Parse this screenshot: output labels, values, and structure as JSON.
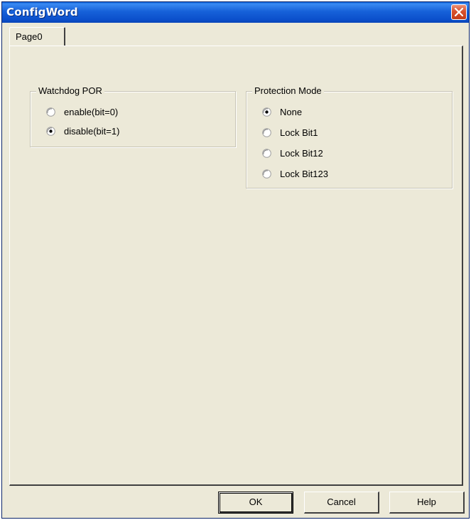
{
  "window": {
    "title": "ConfigWord"
  },
  "tabs": [
    {
      "label": "Page0",
      "selected": true
    }
  ],
  "watchdog": {
    "title": "Watchdog POR",
    "options": [
      {
        "label": "enable(bit=0)",
        "checked": false
      },
      {
        "label": "disable(bit=1)",
        "checked": true
      }
    ]
  },
  "protection": {
    "title": "Protection Mode",
    "options": [
      {
        "label": "None",
        "checked": true
      },
      {
        "label": "Lock Bit1",
        "checked": false
      },
      {
        "label": "Lock Bit12",
        "checked": false
      },
      {
        "label": "Lock Bit123",
        "checked": false
      }
    ]
  },
  "buttons": {
    "ok": "OK",
    "cancel": "Cancel",
    "help": "Help"
  },
  "colors": {
    "titlebar": "#0b4fcb",
    "face": "#ece9d8",
    "close": "#d8502c"
  }
}
